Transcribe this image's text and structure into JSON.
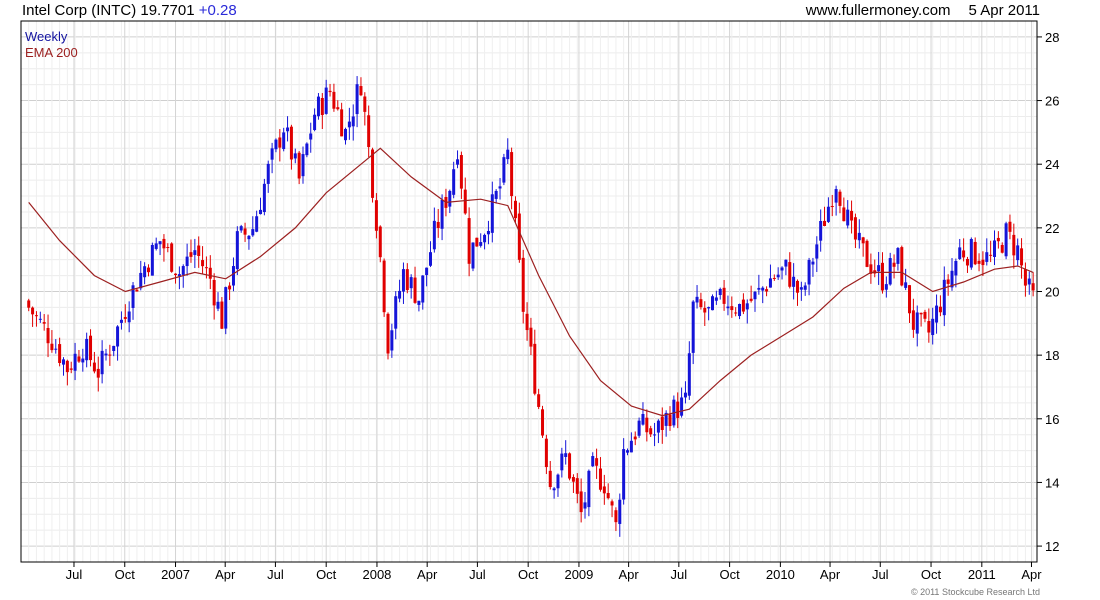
{
  "header": {
    "symbol": "Intel Corp (INTC)",
    "price": "19.7701",
    "change": "+0.28",
    "site": "www.fullermoney.com",
    "date": "5 Apr 2011"
  },
  "copyright": "© 2011 Stockcube Research Ltd",
  "colors": {
    "up": "#1414d8",
    "down": "#e00000",
    "ema": "#9c2020",
    "grid": "#d9d9d9",
    "frame": "#000000"
  },
  "chart_data": {
    "type": "candlestick",
    "interval_label": "Weekly",
    "indicator_label": "EMA 200",
    "legend_position": "top-left",
    "y_axis_position": "right",
    "grid": true,
    "ylim": [
      11.5,
      28.5
    ],
    "y_ticks": [
      12,
      14,
      16,
      18,
      20,
      22,
      24,
      26,
      28
    ],
    "x_ticks": [
      "Jul",
      "Oct",
      "2007",
      "Apr",
      "Jul",
      "Oct",
      "2008",
      "Apr",
      "Jul",
      "Oct",
      "2009",
      "Apr",
      "Jul",
      "Oct",
      "2010",
      "Apr",
      "Jul",
      "Oct",
      "2011",
      "Apr"
    ],
    "close_path": [
      [
        "2006-04-10",
        19.5
      ],
      [
        "2006-05-22",
        18.5
      ],
      [
        "2006-06-19",
        17.6
      ],
      [
        "2006-07-17",
        18.3
      ],
      [
        "2006-08-14",
        17.5
      ],
      [
        "2006-09-11",
        18.5
      ],
      [
        "2006-10-09",
        19.8
      ],
      [
        "2006-11-06",
        20.8
      ],
      [
        "2006-12-04",
        21.6
      ],
      [
        "2007-01-08",
        20.6
      ],
      [
        "2007-02-05",
        21.3
      ],
      [
        "2007-03-05",
        20.4
      ],
      [
        "2007-03-26",
        19.1
      ],
      [
        "2007-04-23",
        21.6
      ],
      [
        "2007-05-21",
        22.0
      ],
      [
        "2007-06-18",
        23.8
      ],
      [
        "2007-07-16",
        25.2
      ],
      [
        "2007-08-13",
        23.5
      ],
      [
        "2007-09-10",
        25.6
      ],
      [
        "2007-10-08",
        26.3
      ],
      [
        "2007-11-05",
        25.0
      ],
      [
        "2007-12-03",
        26.6
      ],
      [
        "2008-01-02",
        22.0
      ],
      [
        "2008-01-21",
        18.4
      ],
      [
        "2008-02-18",
        20.6
      ],
      [
        "2008-03-17",
        19.8
      ],
      [
        "2008-04-14",
        21.8
      ],
      [
        "2008-05-12",
        23.3
      ],
      [
        "2008-05-26",
        24.6
      ],
      [
        "2008-06-16",
        21.2
      ],
      [
        "2008-07-14",
        22.0
      ],
      [
        "2008-08-11",
        23.3
      ],
      [
        "2008-08-25",
        24.3
      ],
      [
        "2008-09-22",
        19.5
      ],
      [
        "2008-10-13",
        17.2
      ],
      [
        "2008-11-10",
        14.0
      ],
      [
        "2008-12-08",
        14.8
      ],
      [
        "2009-01-05",
        13.0
      ],
      [
        "2009-01-26",
        14.4
      ],
      [
        "2009-02-16",
        14.0
      ],
      [
        "2009-03-09",
        12.6
      ],
      [
        "2009-03-23",
        15.0
      ],
      [
        "2009-04-20",
        15.8
      ],
      [
        "2009-05-18",
        15.5
      ],
      [
        "2009-06-15",
        16.2
      ],
      [
        "2009-07-13",
        16.5
      ],
      [
        "2009-07-27",
        19.5
      ],
      [
        "2009-08-24",
        19.3
      ],
      [
        "2009-09-21",
        19.8
      ],
      [
        "2009-10-19",
        19.5
      ],
      [
        "2009-11-16",
        19.8
      ],
      [
        "2009-12-14",
        20.4
      ],
      [
        "2010-01-11",
        20.7
      ],
      [
        "2010-02-08",
        19.8
      ],
      [
        "2010-03-08",
        21.5
      ],
      [
        "2010-04-12",
        23.5
      ],
      [
        "2010-05-10",
        21.8
      ],
      [
        "2010-06-07",
        21.0
      ],
      [
        "2010-07-05",
        20.4
      ],
      [
        "2010-08-02",
        21.0
      ],
      [
        "2010-08-30",
        19.0
      ],
      [
        "2010-09-27",
        18.7
      ],
      [
        "2010-10-25",
        20.0
      ],
      [
        "2010-11-22",
        21.3
      ],
      [
        "2010-12-20",
        21.2
      ],
      [
        "2011-01-17",
        21.0
      ],
      [
        "2011-02-14",
        21.8
      ],
      [
        "2011-03-07",
        21.3
      ],
      [
        "2011-03-21",
        20.2
      ],
      [
        "2011-04-04",
        19.77
      ]
    ],
    "ema_200": [
      [
        "2006-04-10",
        22.8
      ],
      [
        "2006-06-05",
        21.6
      ],
      [
        "2006-08-07",
        20.5
      ],
      [
        "2006-10-02",
        20.0
      ],
      [
        "2006-12-04",
        20.3
      ],
      [
        "2007-02-05",
        20.6
      ],
      [
        "2007-04-02",
        20.4
      ],
      [
        "2007-06-04",
        21.1
      ],
      [
        "2007-08-06",
        22.0
      ],
      [
        "2007-10-01",
        23.1
      ],
      [
        "2007-12-03",
        24.0
      ],
      [
        "2008-01-07",
        24.5
      ],
      [
        "2008-03-03",
        23.6
      ],
      [
        "2008-05-05",
        22.8
      ],
      [
        "2008-07-07",
        22.9
      ],
      [
        "2008-08-25",
        22.7
      ],
      [
        "2008-10-20",
        20.5
      ],
      [
        "2008-12-15",
        18.6
      ],
      [
        "2009-02-09",
        17.2
      ],
      [
        "2009-04-06",
        16.4
      ],
      [
        "2009-06-01",
        16.1
      ],
      [
        "2009-07-20",
        16.3
      ],
      [
        "2009-09-14",
        17.2
      ],
      [
        "2009-11-09",
        18.0
      ],
      [
        "2010-01-04",
        18.6
      ],
      [
        "2010-03-01",
        19.2
      ],
      [
        "2010-04-26",
        20.1
      ],
      [
        "2010-06-14",
        20.6
      ],
      [
        "2010-08-09",
        20.6
      ],
      [
        "2010-10-04",
        20.0
      ],
      [
        "2010-11-29",
        20.3
      ],
      [
        "2011-01-24",
        20.7
      ],
      [
        "2011-03-07",
        20.8
      ],
      [
        "2011-04-04",
        20.6
      ]
    ]
  }
}
